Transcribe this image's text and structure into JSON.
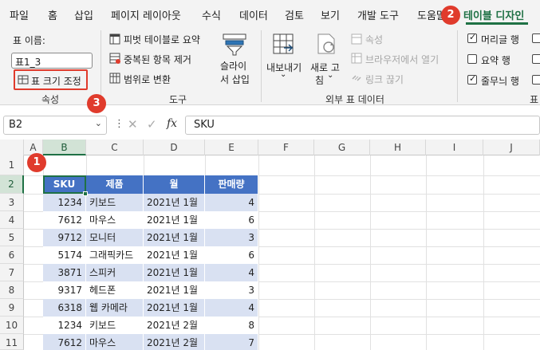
{
  "menu": {
    "tabs": [
      "파일",
      "홈",
      "삽입",
      "페이지 레이아웃",
      "수식",
      "데이터",
      "검토",
      "보기",
      "개발 도구",
      "도움말",
      "테이블 디자인"
    ],
    "active_tab": "테이블 디자인"
  },
  "ribbon": {
    "props": {
      "table_name_label": "표 이름:",
      "table_name_value": "표1_3",
      "resize_label": "표 크기 조정",
      "group_label": "속성"
    },
    "tools": {
      "summarize_pivot": "피벗 테이블로 요약",
      "remove_duplicates": "중복된 항목 제거",
      "convert_to_range": "범위로 변환",
      "insert_slicer_line1": "슬라이",
      "insert_slicer_line2": "서 삽입",
      "group_label": "도구"
    },
    "external": {
      "export_line1": "내보내기",
      "refresh_line1": "새로 고",
      "refresh_line2": "침",
      "properties": "속성",
      "open_in_browser": "브라우저에서 열기",
      "unlink": "링크 끊기",
      "group_label": "외부 표 데이터"
    },
    "style_options": {
      "header_row": "머리글 행",
      "total_row": "요약 행",
      "banded_rows": "줄무늬 행",
      "header_row_checked": true,
      "total_row_checked": false,
      "banded_rows_checked": true,
      "group_label_partial": "표"
    }
  },
  "callouts": [
    "1",
    "2",
    "3"
  ],
  "formula_bar": {
    "name_box": "B2",
    "fx_label": "fx",
    "value": "SKU"
  },
  "grid": {
    "columns": [
      "A",
      "B",
      "C",
      "D",
      "E",
      "F",
      "G",
      "H",
      "I",
      "J"
    ],
    "rows": [
      "1",
      "2",
      "3",
      "4",
      "5",
      "6",
      "7",
      "8",
      "9",
      "10",
      "11"
    ],
    "selected_column": "B",
    "selected_row": "2"
  },
  "table": {
    "headers": [
      "SKU",
      "제품",
      "월",
      "판매량"
    ],
    "rows": [
      [
        "1234",
        "키보드",
        "2021년 1월",
        "4"
      ],
      [
        "7612",
        "마우스",
        "2021년 1월",
        "6"
      ],
      [
        "9712",
        "모니터",
        "2021년 1월",
        "3"
      ],
      [
        "5174",
        "그래픽카드",
        "2021년 1월",
        "6"
      ],
      [
        "3871",
        "스피커",
        "2021년 1월",
        "4"
      ],
      [
        "9317",
        "헤드폰",
        "2021년 1월",
        "3"
      ],
      [
        "6318",
        "웹 카메라",
        "2021년 1월",
        "4"
      ],
      [
        "1234",
        "키보드",
        "2021년 2월",
        "8"
      ],
      [
        "7612",
        "마우스",
        "2021년 2월",
        "7"
      ]
    ]
  },
  "colors": {
    "accent_green": "#1f7145",
    "table_header": "#4472c4",
    "band": "#d9e1f2",
    "callout_red": "#e03b2c"
  }
}
